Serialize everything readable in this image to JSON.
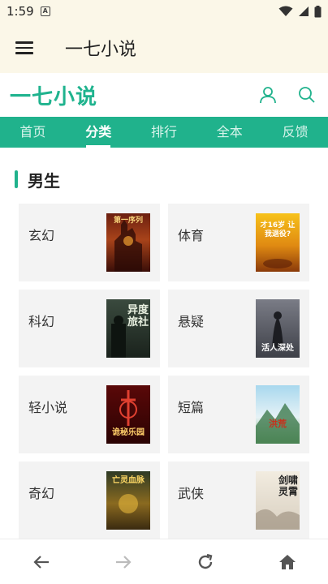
{
  "status": {
    "time": "1:59"
  },
  "app_bar": {
    "title": "一七小说"
  },
  "site": {
    "logo": "一七小说"
  },
  "nav": {
    "tabs": [
      "首页",
      "分类",
      "排行",
      "全本",
      "反馈"
    ]
  },
  "section": {
    "title": "男生"
  },
  "categories": [
    {
      "label": "玄幻",
      "cover_text": "第一序列"
    },
    {
      "label": "体育",
      "cover_text": "才16岁 让我退役?"
    },
    {
      "label": "科幻",
      "cover_text": "异度旅社"
    },
    {
      "label": "悬疑",
      "cover_text": "活人深处"
    },
    {
      "label": "轻小说",
      "cover_text": "诡秘乐园"
    },
    {
      "label": "短篇",
      "cover_text": "洪荒"
    },
    {
      "label": "奇幻",
      "cover_text": "亡灵血脉"
    },
    {
      "label": "武侠",
      "cover_text": "剑啸灵霄"
    }
  ],
  "colors": {
    "accent": "#20b28c",
    "logo": "#1fb38e",
    "bar_bg": "#fbf7e8"
  }
}
